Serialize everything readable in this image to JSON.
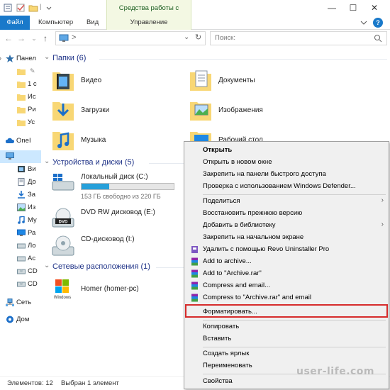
{
  "titlebar": {
    "contextual_group": "Средства работы с дисками",
    "min": "—",
    "max": "☐",
    "close": "✕"
  },
  "ribbon": {
    "file": "Файл",
    "computer": "Компьютер",
    "view": "Вид",
    "manage": "Управление",
    "help": "?"
  },
  "address": {
    "path_sep": ">",
    "search_placeholder": "Поиск:"
  },
  "nav": {
    "items": [
      {
        "label": "Панел"
      },
      {
        "label": ""
      },
      {
        "label": "1 с"
      },
      {
        "label": "Ис"
      },
      {
        "label": "Ри"
      },
      {
        "label": "Ус"
      },
      {
        "label": "OneI"
      },
      {
        "label": ""
      },
      {
        "label": "Ви"
      },
      {
        "label": "До"
      },
      {
        "label": "За"
      },
      {
        "label": "Из"
      },
      {
        "label": "Му"
      },
      {
        "label": "Ра"
      },
      {
        "label": "Ло"
      },
      {
        "label": "Ac"
      },
      {
        "label": "CD"
      },
      {
        "label": "CD"
      },
      {
        "label": "Сеть"
      },
      {
        "label": "Дом"
      }
    ]
  },
  "content": {
    "folders_header": "Папки (6)",
    "folders": [
      {
        "name": "Видео"
      },
      {
        "name": "Документы"
      },
      {
        "name": "Загрузки"
      },
      {
        "name": "Изображения"
      },
      {
        "name": "Музыка"
      },
      {
        "name": "Рабочий стол"
      }
    ],
    "drives_header": "Устройства и диски (5)",
    "drives": [
      {
        "name": "Локальный диск (C:)",
        "free": "153 ГБ свободно из 220 ГБ",
        "used_fraction": 0.3
      },
      {
        "name": "DVD RW дисковод (E:)"
      },
      {
        "name": "CD-дисковод (I:)"
      }
    ],
    "network_header": "Сетевые расположения (1)",
    "network": [
      {
        "name": "Homer (homer-pc)"
      }
    ]
  },
  "status": {
    "count": "Элементов: 12",
    "selected": "Выбран 1 элемент"
  },
  "context_menu": {
    "items": [
      {
        "label": "Открыть",
        "bold": true
      },
      {
        "label": "Открыть в новом окне"
      },
      {
        "label": "Закрепить на панели быстрого доступа"
      },
      {
        "label": "Проверка с использованием Windows Defender..."
      },
      {
        "label": "Поделиться",
        "submenu": true
      },
      {
        "label": "Восстановить прежнюю версию"
      },
      {
        "label": "Добавить в библиотеку",
        "submenu": true
      },
      {
        "label": "Закрепить на начальном экране"
      },
      {
        "label": "Удалить с помощью Revo Uninstaller Pro"
      },
      {
        "label": "Add to archive..."
      },
      {
        "label": "Add to \"Archive.rar\""
      },
      {
        "label": "Compress and email..."
      },
      {
        "label": "Compress to \"Archive.rar\" and email"
      },
      {
        "label": "Форматировать..."
      },
      {
        "label": "Копировать"
      },
      {
        "label": "Вставить"
      },
      {
        "label": "Создать ярлык"
      },
      {
        "label": "Переименовать"
      },
      {
        "label": "Свойства"
      }
    ],
    "submenu_arrow": "›"
  },
  "watermark": "user-life.com",
  "colors": {
    "accent": "#1979ca",
    "contextual_tab": "#f3f8e3",
    "highlight": "#d62c2c",
    "selection": "#cce8ff"
  }
}
